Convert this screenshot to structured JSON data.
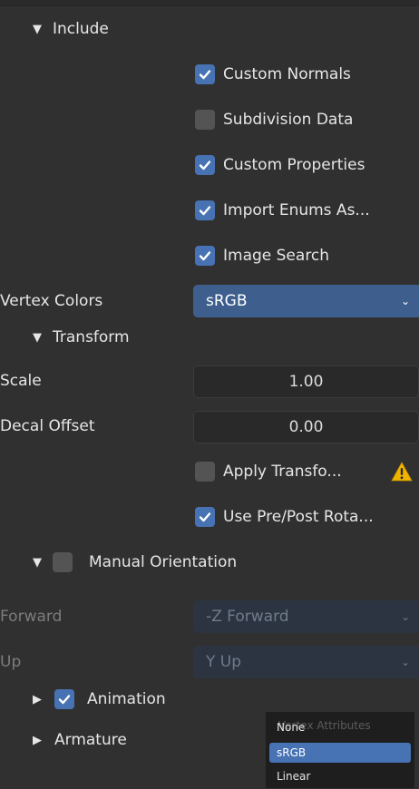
{
  "colors": {
    "background": "#303030",
    "checkbox_on": "#4772b3",
    "checkbox_off": "#545454",
    "select_active": "#3e5e8e",
    "warning": "#f0b400"
  },
  "include": {
    "title": "Include",
    "options": [
      {
        "label": "Custom Normals",
        "checked": true
      },
      {
        "label": "Subdivision Data",
        "checked": false
      },
      {
        "label": "Custom Properties",
        "checked": true
      },
      {
        "label": "Import Enums As...",
        "checked": true
      },
      {
        "label": "Image Search",
        "checked": true
      }
    ],
    "vertex_colors": {
      "label": "Vertex Colors",
      "value": "sRGB"
    }
  },
  "transform": {
    "title": "Transform",
    "scale": {
      "label": "Scale",
      "value": "1.00"
    },
    "decal_offset": {
      "label": "Decal Offset",
      "value": "0.00"
    },
    "apply_transform": {
      "label": "Apply Transfo...",
      "checked": false,
      "icon": "warning-icon"
    },
    "use_pre_post_rotation": {
      "label": "Use Pre/Post Rota...",
      "checked": true
    },
    "manual_orientation": {
      "title": "Manual Orientation",
      "checked": false,
      "forward": {
        "label": "Forward",
        "value": "-Z Forward"
      },
      "up": {
        "label": "Up",
        "value": "Y Up"
      }
    }
  },
  "animation": {
    "title": "Animation",
    "checked": true
  },
  "armature": {
    "title": "Armature"
  },
  "dropdown_menu": {
    "title": "Vertex Attributes",
    "items": [
      {
        "label": "None",
        "selected": false
      },
      {
        "label": "sRGB",
        "selected": true
      },
      {
        "label": "Linear",
        "selected": false
      }
    ]
  }
}
